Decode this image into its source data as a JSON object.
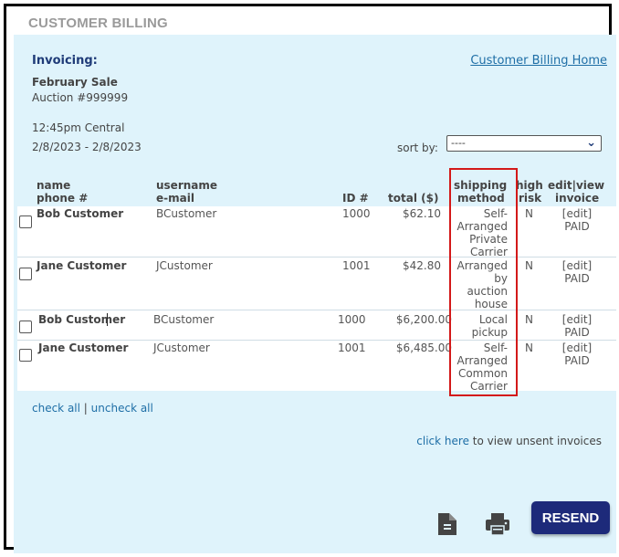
{
  "section_title": "CUSTOMER BILLING",
  "invoicing_label": "Invoicing:",
  "home_link": "Customer Billing Home",
  "sale": {
    "name": "February Sale",
    "auction": "Auction #999999"
  },
  "time": "12:45pm Central",
  "dates": "2/8/2023 - 2/8/2023",
  "sort": {
    "label": "sort by:",
    "value": "----"
  },
  "headers": {
    "name": "name",
    "phone": "phone #",
    "username": "username",
    "email": "e-mail",
    "id": "ID #",
    "total": "total ($)",
    "shipping1": "shipping",
    "shipping2": "method",
    "risk1": "high",
    "risk2": "risk",
    "invoice1": "edit|view",
    "invoice2": "invoice"
  },
  "rows": [
    {
      "name": "Bob Customer",
      "username": "BCustomer",
      "id": "1000",
      "total": "$62.10",
      "shipping": [
        "Self-",
        "Arranged",
        "Private",
        "Carrier"
      ],
      "risk": "N",
      "edit": "[edit]",
      "status": "PAID"
    },
    {
      "name": "Jane Customer",
      "username": "JCustomer",
      "id": "1001",
      "total": "$42.80",
      "shipping": [
        "Arranged",
        "by",
        "auction",
        "house"
      ],
      "risk": "N",
      "edit": "[edit]",
      "status": "PAID"
    },
    {
      "name": "Bob Customer",
      "username": "BCustomer",
      "id": "1000",
      "total": "$6,200.00",
      "shipping": [
        "Local",
        "pickup"
      ],
      "risk": "N",
      "edit": "[edit]",
      "status": "PAID"
    },
    {
      "name": "Jane Customer",
      "username": "JCustomer",
      "id": "1001",
      "total": "$6,485.00",
      "shipping": [
        "Self-",
        "Arranged",
        "Common",
        "Carrier"
      ],
      "risk": "N",
      "edit": "[edit]",
      "status": "PAID"
    }
  ],
  "check_all": "check all",
  "separator": "|",
  "uncheck_all": "uncheck all",
  "unsent": {
    "link": "click here",
    "text": " to view unsent invoices"
  },
  "resend_label": "RESEND",
  "icons": {
    "document": "document-icon",
    "print": "printer-icon"
  },
  "colors": {
    "panel": "#dff3fb",
    "link": "#1e6ea6",
    "resend": "#1d2a7a",
    "highlight": "#d31919"
  }
}
